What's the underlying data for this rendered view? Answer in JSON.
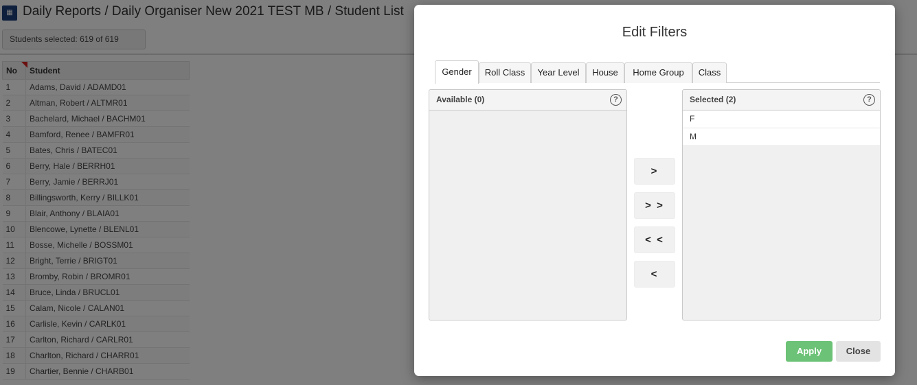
{
  "header": {
    "logo_text": "",
    "title": "Daily Reports / Daily Organiser New 2021 TEST MB / Student List",
    "students_selected": "Students selected: 619 of 619"
  },
  "table": {
    "col_no": "No",
    "col_student": "Student",
    "rows": [
      {
        "no": "1",
        "student": "Adams, David / ADAMD01"
      },
      {
        "no": "2",
        "student": "Altman, Robert / ALTMR01"
      },
      {
        "no": "3",
        "student": "Bachelard, Michael / BACHM01"
      },
      {
        "no": "4",
        "student": "Bamford, Renee / BAMFR01"
      },
      {
        "no": "5",
        "student": "Bates, Chris / BATEC01"
      },
      {
        "no": "6",
        "student": "Berry, Hale / BERRH01"
      },
      {
        "no": "7",
        "student": "Berry, Jamie / BERRJ01"
      },
      {
        "no": "8",
        "student": "Billingsworth, Kerry / BILLK01"
      },
      {
        "no": "9",
        "student": "Blair, Anthony / BLAIA01"
      },
      {
        "no": "10",
        "student": "Blencowe, Lynette / BLENL01"
      },
      {
        "no": "11",
        "student": "Bosse, Michelle / BOSSM01"
      },
      {
        "no": "12",
        "student": "Bright, Terrie / BRIGT01"
      },
      {
        "no": "13",
        "student": "Bromby, Robin / BROMR01"
      },
      {
        "no": "14",
        "student": "Bruce, Linda / BRUCL01"
      },
      {
        "no": "15",
        "student": "Calam, Nicole / CALAN01"
      },
      {
        "no": "16",
        "student": "Carlisle, Kevin / CARLK01"
      },
      {
        "no": "17",
        "student": "Carlton, Richard / CARLR01"
      },
      {
        "no": "18",
        "student": "Charlton, Richard / CHARR01"
      },
      {
        "no": "19",
        "student": "Chartier, Bennie / CHARB01"
      }
    ]
  },
  "modal": {
    "title": "Edit Filters",
    "tabs": [
      {
        "label": "Gender",
        "active": true
      },
      {
        "label": "Roll Class",
        "active": false
      },
      {
        "label": "Year Level",
        "active": false
      },
      {
        "label": "House",
        "active": false
      },
      {
        "label": "Home Group",
        "active": false
      },
      {
        "label": "Class",
        "active": false
      }
    ],
    "available": {
      "header": "Available (0)",
      "items": []
    },
    "selected": {
      "header": "Selected (2)",
      "items": [
        "F",
        "M"
      ]
    },
    "help_glyph": "?",
    "move_buttons": {
      "add_one": ">",
      "add_all": "> >",
      "remove_all": "< <",
      "remove_one": "<"
    },
    "apply_label": "Apply",
    "close_label": "Close"
  },
  "colors": {
    "accent_apply": "#6cc276",
    "overlay": "rgba(0,0,0,0.5)",
    "sort_flag": "#d62020",
    "logo_bg": "#1d3f7a"
  }
}
